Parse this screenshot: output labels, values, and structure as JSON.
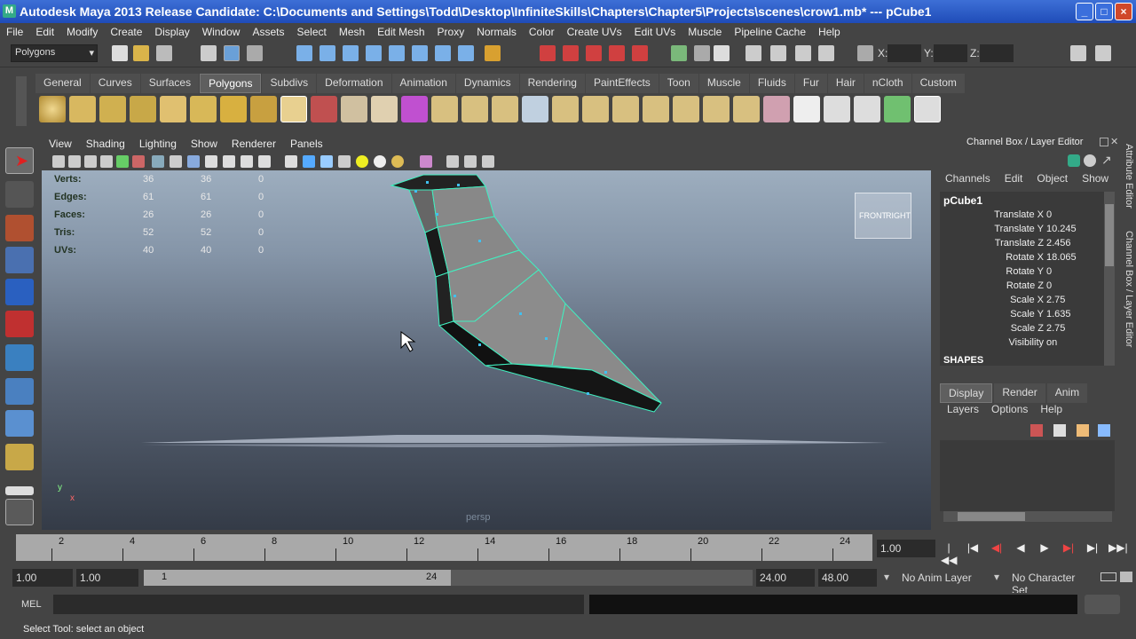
{
  "window": {
    "title": "Autodesk Maya 2013 Release Candidate: C:\\Documents and Settings\\Todd\\Desktop\\InfiniteSkills\\Chapters\\Chapter5\\Projects\\scenes\\crow1.mb*   ---   pCube1",
    "minimize": "_",
    "maximize": "□",
    "close": "×"
  },
  "menu": [
    "File",
    "Edit",
    "Modify",
    "Create",
    "Display",
    "Window",
    "Assets",
    "Select",
    "Mesh",
    "Edit Mesh",
    "Proxy",
    "Normals",
    "Color",
    "Create UVs",
    "Edit UVs",
    "Muscle",
    "Pipeline Cache",
    "Help"
  ],
  "status": {
    "mode": "Polygons",
    "x_label": "X:",
    "y_label": "Y:",
    "z_label": "Z:"
  },
  "shelf": {
    "tabs": [
      "General",
      "Curves",
      "Surfaces",
      "Polygons",
      "Subdivs",
      "Deformation",
      "Animation",
      "Dynamics",
      "Rendering",
      "PaintEffects",
      "Toon",
      "Muscle",
      "Fluids",
      "Fur",
      "Hair",
      "nCloth",
      "Custom"
    ],
    "active_tab": "Polygons"
  },
  "viewport": {
    "menus": [
      "View",
      "Shading",
      "Lighting",
      "Show",
      "Renderer",
      "Panels"
    ],
    "hud": [
      {
        "label": "Verts:",
        "a": "36",
        "b": "36",
        "c": "0"
      },
      {
        "label": "Edges:",
        "a": "61",
        "b": "61",
        "c": "0"
      },
      {
        "label": "Faces:",
        "a": "26",
        "b": "26",
        "c": "0"
      },
      {
        "label": "Tris:",
        "a": "52",
        "b": "52",
        "c": "0"
      },
      {
        "label": "UVs:",
        "a": "40",
        "b": "40",
        "c": "0"
      }
    ],
    "viewcube_front": "FRONT",
    "viewcube_right": "RIGHT",
    "camera": "persp",
    "axis_y": "y",
    "axis_x": "x"
  },
  "channel_box": {
    "title": "Channel Box / Layer Editor",
    "menus": [
      "Channels",
      "Edit",
      "Object",
      "Show"
    ],
    "object": "pCube1",
    "attributes": [
      {
        "name": "Translate X",
        "value": "0"
      },
      {
        "name": "Translate Y",
        "value": "10.245"
      },
      {
        "name": "Translate Z",
        "value": "2.456"
      },
      {
        "name": "Rotate X",
        "value": "18.065"
      },
      {
        "name": "Rotate Y",
        "value": "0"
      },
      {
        "name": "Rotate Z",
        "value": "0"
      },
      {
        "name": "Scale X",
        "value": "2.75"
      },
      {
        "name": "Scale Y",
        "value": "1.635"
      },
      {
        "name": "Scale Z",
        "value": "2.75"
      },
      {
        "name": "Visibility",
        "value": "on"
      }
    ],
    "shapes_label": "SHAPES",
    "layer_tabs": [
      "Display",
      "Render",
      "Anim"
    ],
    "active_layer_tab": "Display",
    "layer_menus": [
      "Layers",
      "Options",
      "Help"
    ]
  },
  "side_tabs": [
    "Attribute Editor",
    "Channel Box / Layer Editor"
  ],
  "timeline": {
    "ticks": [
      "2",
      "4",
      "6",
      "8",
      "10",
      "12",
      "14",
      "16",
      "18",
      "20",
      "22",
      "24"
    ],
    "current_frame": "1.00",
    "playback": [
      "|◀◀",
      "|◀",
      "◀|",
      "◀",
      "▶",
      "▶|",
      "▶|",
      "▶▶|"
    ]
  },
  "range": {
    "start": "1.00",
    "playback_start": "1.00",
    "range_start_label": "1",
    "range_end_label": "24",
    "playback_end": "24.00",
    "end": "48.00",
    "anim_layer": "No Anim Layer",
    "character_set": "No Character Set"
  },
  "command": {
    "label": "MEL"
  },
  "help": {
    "text": "Select Tool: select an object"
  }
}
